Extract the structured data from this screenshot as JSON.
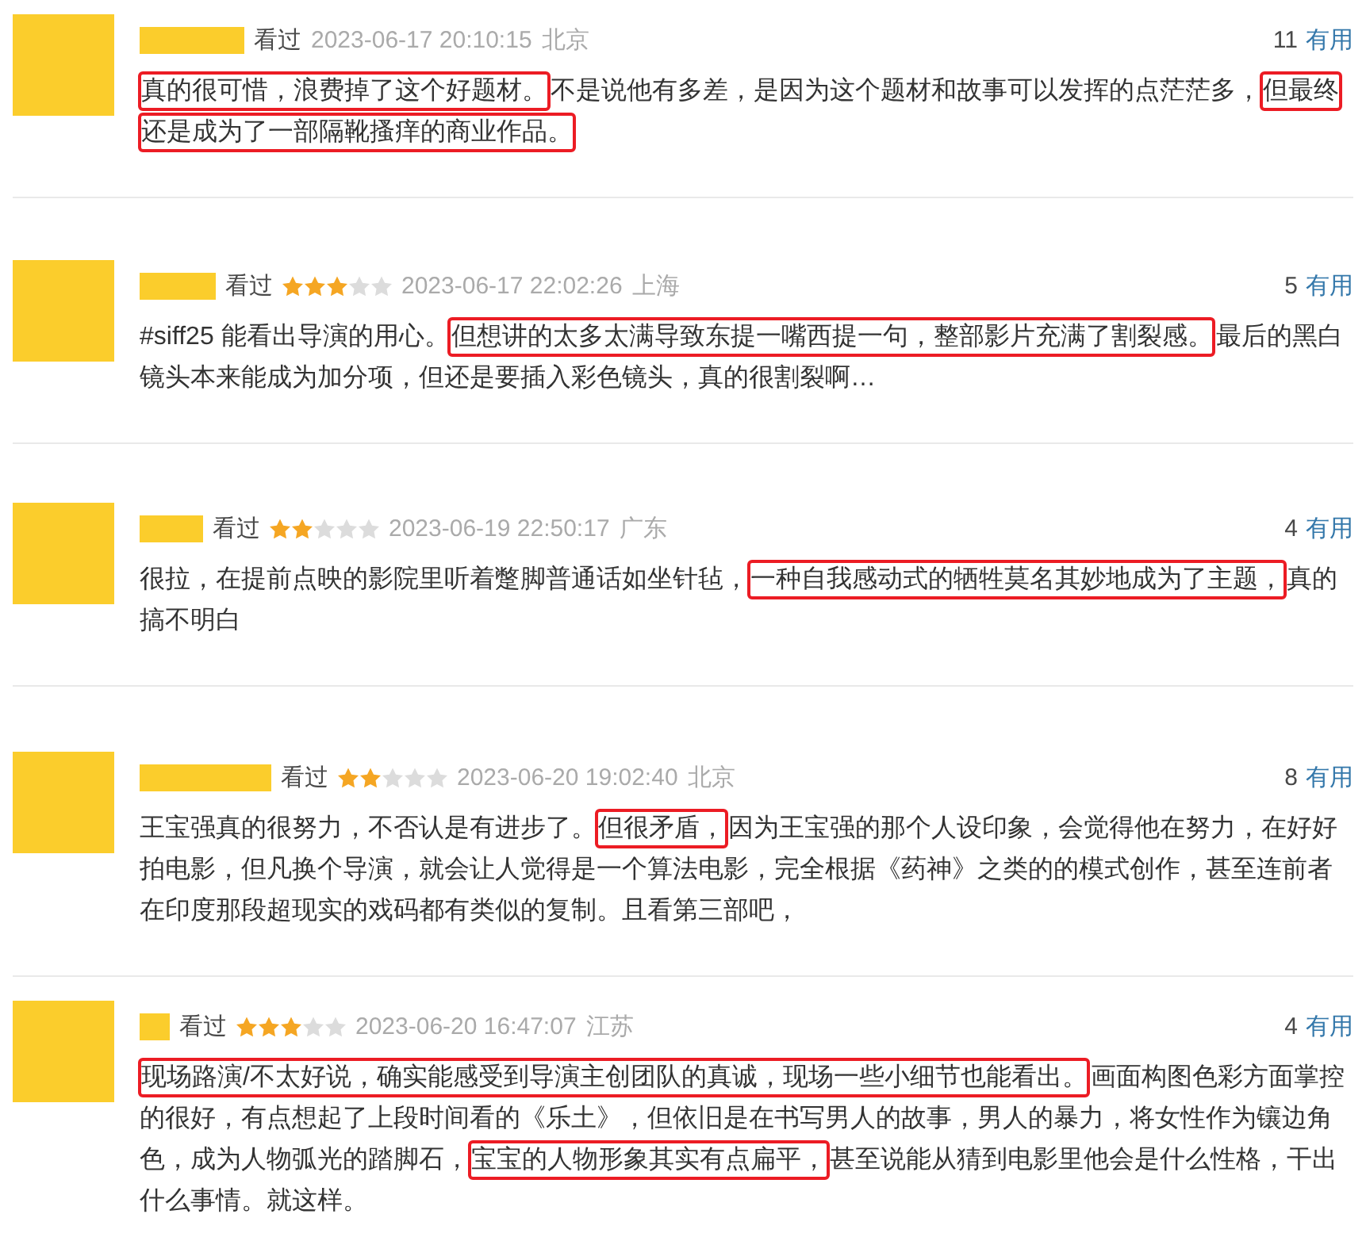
{
  "reviews": [
    {
      "status": "看过",
      "time": "2023-06-17 20:10:15",
      "location": "北京",
      "votes": "11",
      "vote_label": "有用",
      "body": [
        {
          "text": "真的很可惜，浪费掉了这个好题材。",
          "highlighted": true
        },
        {
          "text": "不是说他有多差，是因为这个题材和故事可以发挥的点茫茫多，",
          "highlighted": false
        },
        {
          "text": "但最终还是成为了一部隔靴搔痒的商业作品。",
          "highlighted": true
        }
      ]
    },
    {
      "status": "看过",
      "stars": 3,
      "time": "2023-06-17 22:02:26",
      "location": "上海",
      "votes": "5",
      "vote_label": "有用",
      "body": [
        {
          "text": "#siff25 能看出导演的用心。",
          "highlighted": false
        },
        {
          "text": "但想讲的太多太满导致东提一嘴西提一句，整部影片充满了割裂感。",
          "highlighted": true
        },
        {
          "text": "最后的黑白镜头本来能成为加分项，但还是要插入彩色镜头，真的很割裂啊…",
          "highlighted": false
        }
      ]
    },
    {
      "status": "看过",
      "stars": 2,
      "time": "2023-06-19 22:50:17",
      "location": "广东",
      "votes": "4",
      "vote_label": "有用",
      "body": [
        {
          "text": "很拉，在提前点映的影院里听着蹩脚普通话如坐针毡，",
          "highlighted": false
        },
        {
          "text": "一种自我感动式的牺牲莫名其妙地成为了主题，",
          "highlighted": true
        },
        {
          "text": "真的搞不明白",
          "highlighted": false
        }
      ]
    },
    {
      "status": "看过",
      "stars": 2,
      "time": "2023-06-20 19:02:40",
      "location": "北京",
      "votes": "8",
      "vote_label": "有用",
      "body": [
        {
          "text": "王宝强真的很努力，不否认是有进步了。",
          "highlighted": false
        },
        {
          "text": "但很矛盾，",
          "highlighted": true
        },
        {
          "text": "因为王宝强的那个人设印象，会觉得他在努力，在好好拍电影，但凡换个导演，就会让人觉得是一个算法电影，完全根据《药神》之类的的模式创作，甚至连前者在印度那段超现实的戏码都有类似的复制。且看第三部吧，",
          "highlighted": false
        }
      ]
    },
    {
      "status": "看过",
      "stars": 3,
      "time": "2023-06-20 16:47:07",
      "location": "江苏",
      "votes": "4",
      "vote_label": "有用",
      "body": [
        {
          "text": "现场路演/不太好说，确实能感受到导演主创团队的真诚，现场一些小细节也能看出。",
          "highlighted": true
        },
        {
          "text": "画面构图色彩方面掌控的很好，有点想起了上段时间看的《乐土》，但依旧是在书写男人的故事，男人的暴力，将女性作为镶边角色，成为人物弧光的踏脚石，",
          "highlighted": false
        },
        {
          "text": "宝宝的人物形象其实有点扁平，",
          "highlighted": true
        },
        {
          "text": "甚至说能从猜到电影里他会是什么性格，干出什么事情。就这样。",
          "highlighted": false
        }
      ]
    }
  ]
}
